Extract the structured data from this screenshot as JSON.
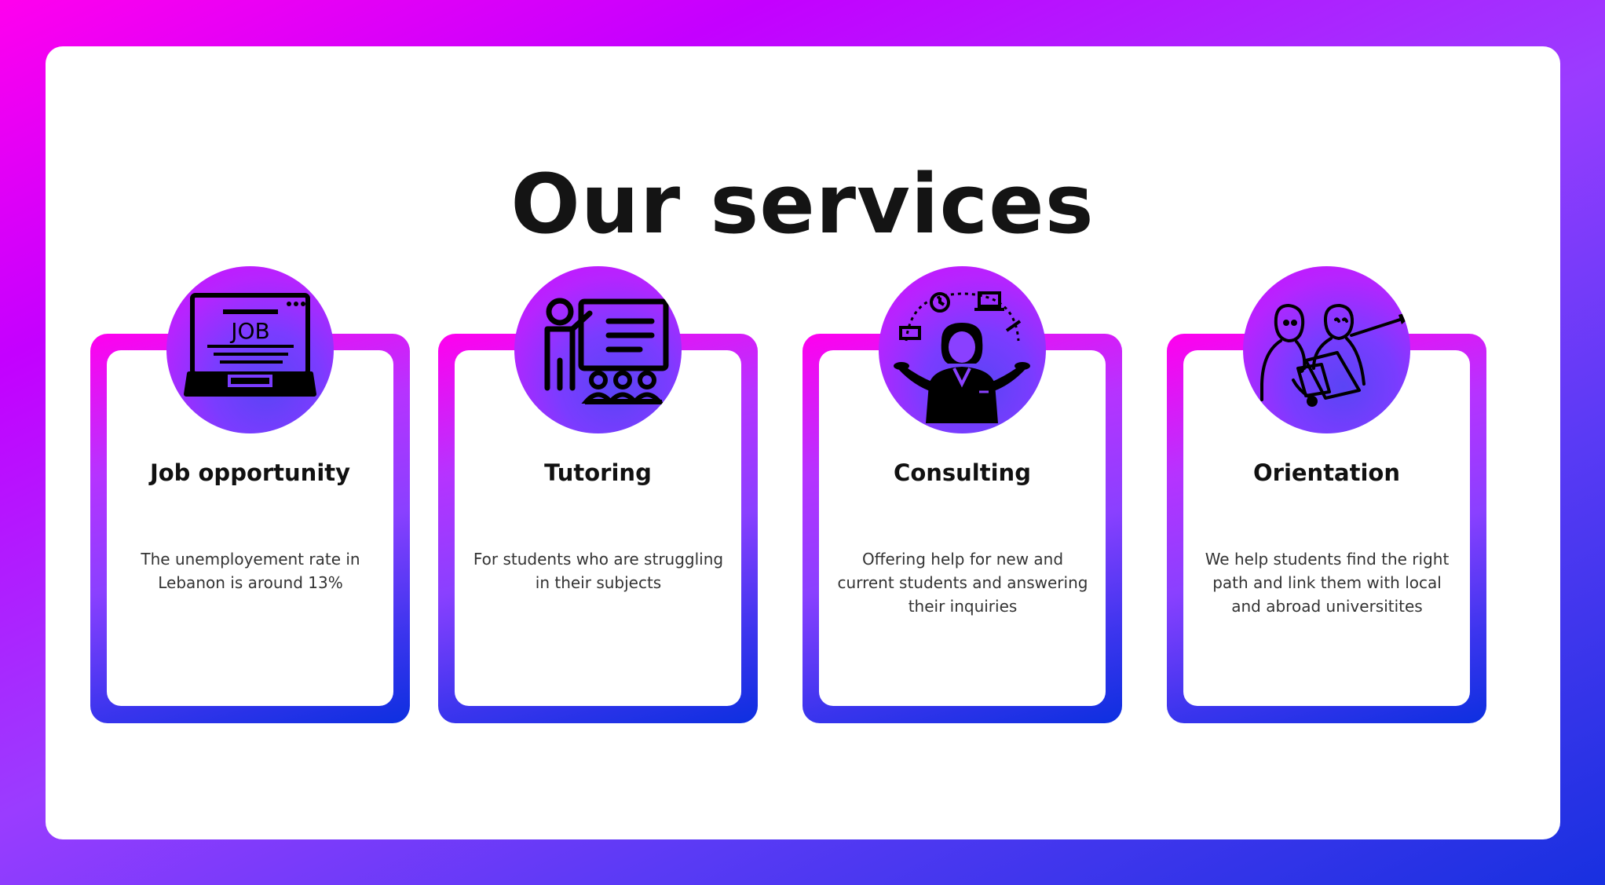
{
  "title": "Our services",
  "services": [
    {
      "title": "Job opportunity",
      "description": "The unemployement rate in Lebanon is around 13%",
      "icon": "laptop-job-icon",
      "icon_text": "JOB"
    },
    {
      "title": "Tutoring",
      "description": "For students who are struggling in their subjects",
      "icon": "teacher-presentation-icon"
    },
    {
      "title": "Consulting",
      "description": "Offering help for new and current students and answering their inquiries",
      "icon": "consultant-woman-icon"
    },
    {
      "title": "Orientation",
      "description": "We help students find the right path and link them with local and abroad universitites",
      "icon": "guidance-people-icon"
    }
  ],
  "colors": {
    "gradient_start": "#ff00ee",
    "gradient_mid": "#9a3cff",
    "gradient_end": "#1830e0",
    "panel": "#ffffff",
    "text": "#141414"
  }
}
